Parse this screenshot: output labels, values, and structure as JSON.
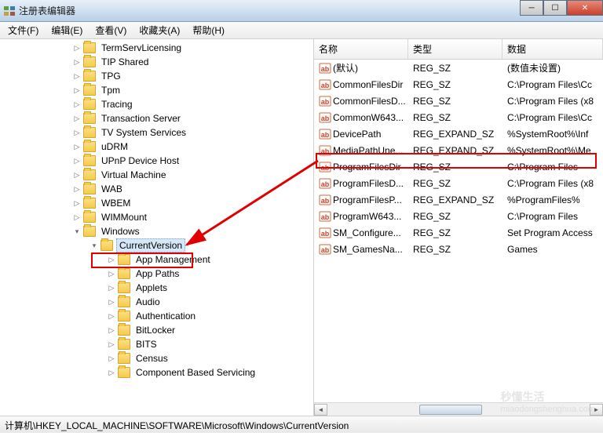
{
  "title": "注册表编辑器",
  "menu": [
    "文件(F)",
    "编辑(E)",
    "查看(V)",
    "收藏夹(A)",
    "帮助(H)"
  ],
  "tree_top": [
    "TermServLicensing",
    "TIP Shared",
    "TPG",
    "Tpm",
    "Tracing",
    "Transaction Server",
    "TV System Services",
    "uDRM",
    "UPnP Device Host",
    "Virtual Machine",
    "WAB",
    "WBEM",
    "WIMMount"
  ],
  "tree_windows": "Windows",
  "tree_currentversion": "CurrentVersion",
  "tree_cv_children": [
    "App Management",
    "App Paths",
    "Applets",
    "Audio",
    "Authentication",
    "BitLocker",
    "BITS",
    "Census",
    "Component Based Servicing"
  ],
  "columns": {
    "name": "名称",
    "type": "类型",
    "data": "数据"
  },
  "values": [
    {
      "n": "(默认)",
      "t": "REG_SZ",
      "d": "(数值未设置)"
    },
    {
      "n": "CommonFilesDir",
      "t": "REG_SZ",
      "d": "C:\\Program Files\\Cc"
    },
    {
      "n": "CommonFilesD...",
      "t": "REG_SZ",
      "d": "C:\\Program Files (x8"
    },
    {
      "n": "CommonW643...",
      "t": "REG_SZ",
      "d": "C:\\Program Files\\Cc"
    },
    {
      "n": "DevicePath",
      "t": "REG_EXPAND_SZ",
      "d": "%SystemRoot%\\Inf"
    },
    {
      "n": "MediaPathUne...",
      "t": "REG_EXPAND_SZ",
      "d": "%SystemRoot%\\Me"
    },
    {
      "n": "ProgramFilesDir",
      "t": "REG_SZ",
      "d": "C:\\Program Files"
    },
    {
      "n": "ProgramFilesD...",
      "t": "REG_SZ",
      "d": "C:\\Program Files (x8"
    },
    {
      "n": "ProgramFilesP...",
      "t": "REG_EXPAND_SZ",
      "d": "%ProgramFiles%"
    },
    {
      "n": "ProgramW643...",
      "t": "REG_SZ",
      "d": "C:\\Program Files"
    },
    {
      "n": "SM_Configure...",
      "t": "REG_SZ",
      "d": "Set Program Access"
    },
    {
      "n": "SM_GamesNa...",
      "t": "REG_SZ",
      "d": "Games"
    }
  ],
  "statusbar": "计算机\\HKEY_LOCAL_MACHINE\\SOFTWARE\\Microsoft\\Windows\\CurrentVersion",
  "watermark": "秒懂生活",
  "watermark_sub": "miaodongshenghua.com"
}
